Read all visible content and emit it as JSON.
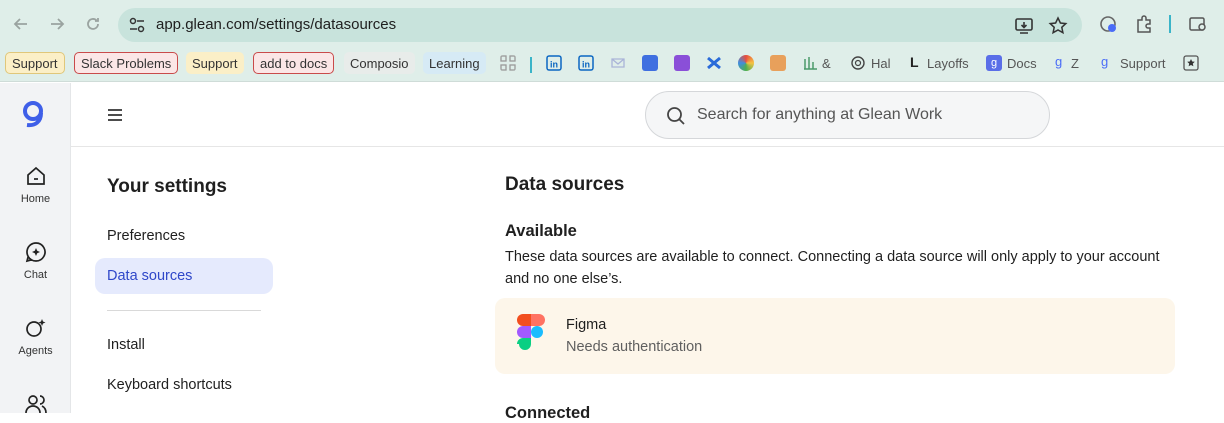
{
  "browser": {
    "url": "app.glean.com/settings/datasources",
    "bookmarks": [
      {
        "label": "Support"
      },
      {
        "label": "Slack Problems"
      },
      {
        "label": "Support"
      },
      {
        "label": "add to docs"
      },
      {
        "label": "Composio"
      },
      {
        "label": "Learning"
      },
      {
        "label": "&"
      },
      {
        "label": "Hal"
      },
      {
        "label": "Layoffs"
      },
      {
        "label": "Docs"
      },
      {
        "label": "Z"
      },
      {
        "label": "Support"
      }
    ]
  },
  "rail": {
    "items": [
      {
        "label": "Home",
        "icon": "home-icon"
      },
      {
        "label": "Chat",
        "icon": "chat-icon"
      },
      {
        "label": "Agents",
        "icon": "agents-icon"
      }
    ]
  },
  "header": {
    "search_placeholder": "Search for anything at Glean Work"
  },
  "settings": {
    "title": "Your settings",
    "nav": [
      {
        "label": "Preferences"
      },
      {
        "label": "Data sources",
        "active": true
      },
      {
        "label": "Install"
      },
      {
        "label": "Keyboard shortcuts"
      }
    ]
  },
  "main": {
    "title": "Data sources",
    "available_title": "Available",
    "available_desc": "These data sources are available to connect. Connecting a data source will only apply to your account and no one else’s.",
    "sources": [
      {
        "name": "Figma",
        "status": "Needs authentication"
      }
    ],
    "next_section": "Connected"
  },
  "colors": {
    "accent": "#2f47c9",
    "active_bg": "#e5eafd",
    "card_bg": "#fdf6ea"
  }
}
